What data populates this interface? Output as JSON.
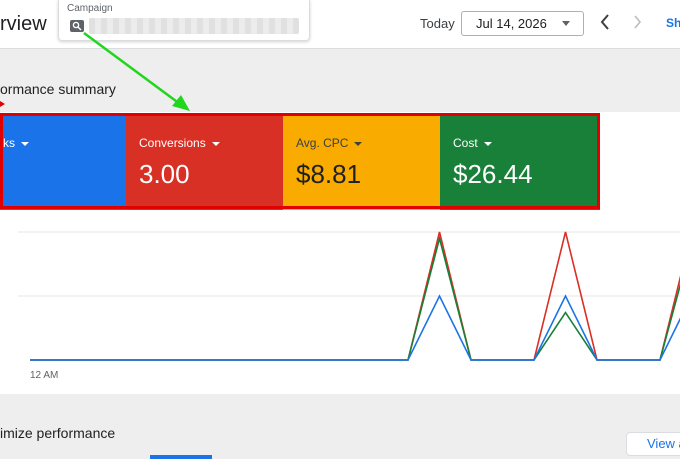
{
  "header": {
    "page_title": "rview",
    "campaign_label": "Campaign",
    "today_label": "Today",
    "date_value": "Jul 14, 2026",
    "show_link": "Sh"
  },
  "summary": {
    "title": "ormance summary",
    "scorecards": [
      {
        "label": "cks",
        "value": "",
        "color": "#1a73e8"
      },
      {
        "label": "Conversions",
        "value": "3.00",
        "color": "#d93025"
      },
      {
        "label": "Avg. CPC",
        "value": "$8.81",
        "color": "#f9ab00"
      },
      {
        "label": "Cost",
        "value": "$26.44",
        "color": "#188038"
      }
    ]
  },
  "chart": {
    "x_tick_label": "12 AM"
  },
  "chart_data": {
    "type": "line",
    "x": [
      0,
      1,
      2,
      3,
      4,
      5,
      6,
      7,
      8,
      9,
      10,
      11,
      12,
      13,
      14,
      15,
      16,
      17,
      18,
      19,
      20,
      21,
      22,
      23
    ],
    "series": [
      {
        "color": "#d93025",
        "values": [
          0,
          0,
          0,
          0,
          0,
          0,
          0,
          0,
          0,
          0,
          0,
          0,
          0,
          1.0,
          0,
          0,
          0,
          1.0,
          0,
          0,
          0,
          1.0,
          0,
          0
        ]
      },
      {
        "color": "#188038",
        "values": [
          0,
          0,
          0,
          0,
          0,
          0,
          0,
          0,
          0,
          0,
          0,
          0,
          0,
          0.95,
          0,
          0,
          0,
          0.37,
          0,
          0,
          0,
          0.91,
          0,
          0
        ]
      },
      {
        "color": "#1a73e8",
        "values": [
          0,
          0,
          0,
          0,
          0,
          0,
          0,
          0,
          0,
          0,
          0,
          0,
          0,
          0.5,
          0,
          0,
          0,
          0.5,
          0,
          0,
          0,
          0.5,
          0,
          0
        ]
      }
    ]
  },
  "optimization": {
    "title": "imize performance",
    "view_all": "View a"
  }
}
